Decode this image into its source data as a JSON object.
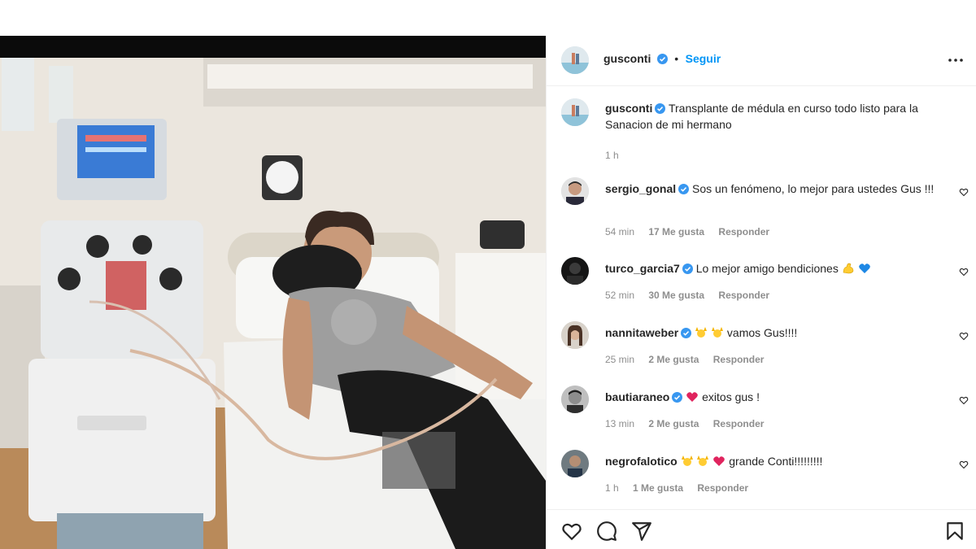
{
  "post": {
    "author": "gusconti",
    "follow_label": "Seguir",
    "dot": "•",
    "caption": "Transplante de médula en curso todo listo para la Sanacion de mi hermano",
    "caption_time": "1 h"
  },
  "icons": {
    "more": "more-options-icon",
    "verified": "verified-badge-icon",
    "like": "heart-icon",
    "comment": "comment-icon",
    "share": "share-icon",
    "save": "bookmark-icon"
  },
  "colors": {
    "link": "#0095f6",
    "verified": "#3897f0",
    "muted": "#8e8e8e",
    "text": "#262626"
  },
  "comments": [
    {
      "user": "sergio_gonal",
      "verified": true,
      "text": "Sos un fenómeno, lo mejor para ustedes Gus !!!",
      "time": "54 min",
      "likes": "17 Me gusta",
      "reply": "Responder"
    },
    {
      "user": "turco_garcia7",
      "verified": true,
      "text": "Lo mejor amigo bendiciones",
      "emojis": [
        "flexed-biceps",
        "blue-heart"
      ],
      "time": "52 min",
      "likes": "30 Me gusta",
      "reply": "Responder"
    },
    {
      "user": "nannitaweber",
      "verified": true,
      "text": "vamos Gus!!!!",
      "emojis": [
        "raising-hands",
        "raising-hands"
      ],
      "time": "25 min",
      "likes": "2 Me gusta",
      "reply": "Responder"
    },
    {
      "user": "bautiaraneo",
      "verified": true,
      "text": "exitos gus !",
      "emojis": [
        "red-heart"
      ],
      "time": "13 min",
      "likes": "2 Me gusta",
      "reply": "Responder"
    },
    {
      "user": "negrofalotico",
      "verified": false,
      "text": "grande Conti!!!!!!!!!",
      "emojis": [
        "raising-hands",
        "raising-hands",
        "red-heart"
      ],
      "time": "1 h",
      "likes": "1 Me gusta",
      "reply": "Responder"
    }
  ]
}
